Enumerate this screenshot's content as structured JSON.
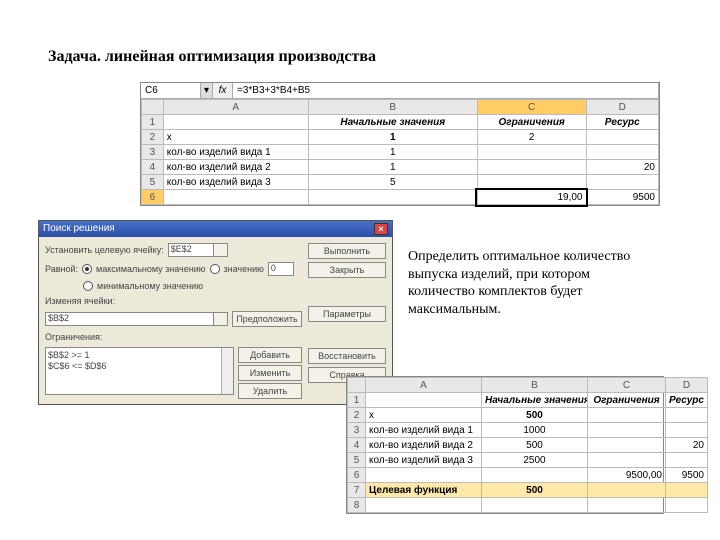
{
  "title": "Задача. линейная оптимизация производства",
  "description": "Определить оптимальное количество выпуска изделий, при котором количество комплектов будет максимальным.",
  "formula_bar": {
    "cell": "C6",
    "formula": "=3*B3+3*B4+B5"
  },
  "sheet1": {
    "cols": [
      "",
      "A",
      "B",
      "C",
      "D"
    ],
    "header": {
      "b": "Начальные значения",
      "c": "Ограничения",
      "d": "Ресурс"
    },
    "rows": [
      {
        "n": "1",
        "a": "",
        "b": "",
        "c": "",
        "d": ""
      },
      {
        "n": "2",
        "a": "x",
        "b": "1",
        "c": "2",
        "d": ""
      },
      {
        "n": "3",
        "a": "кол-во изделий вида 1",
        "b": "1",
        "c": "",
        "d": ""
      },
      {
        "n": "4",
        "a": "кол-во изделий вида 2",
        "b": "1",
        "c": "",
        "d": "20"
      },
      {
        "n": "5",
        "a": "кол-во изделий вида 3",
        "b": "5",
        "c": "",
        "d": ""
      },
      {
        "n": "6",
        "a": "",
        "b": "",
        "c": "19,00",
        "d": "9500"
      }
    ]
  },
  "sheet2": {
    "cols": [
      "",
      "A",
      "B",
      "C",
      "D"
    ],
    "header": {
      "b": "Начальные значения",
      "c": "Ограничения",
      "d": "Ресурс"
    },
    "rows": [
      {
        "n": "1",
        "a": "",
        "b": "",
        "c": "",
        "d": ""
      },
      {
        "n": "2",
        "a": "x",
        "b": "500",
        "c": "",
        "d": ""
      },
      {
        "n": "3",
        "a": "кол-во изделий вида 1",
        "b": "1000",
        "c": "",
        "d": ""
      },
      {
        "n": "4",
        "a": "кол-во изделий вида 2",
        "b": "500",
        "c": "",
        "d": "20"
      },
      {
        "n": "5",
        "a": "кол-во изделий вида 3",
        "b": "2500",
        "c": "",
        "d": ""
      },
      {
        "n": "6",
        "a": "",
        "b": "",
        "c": "9500,00",
        "d": "9500"
      },
      {
        "n": "7",
        "a": "Целевая функция",
        "b": "500",
        "c": "",
        "d": ""
      },
      {
        "n": "8",
        "a": "",
        "b": "",
        "c": "",
        "d": ""
      }
    ]
  },
  "solver": {
    "title": "Поиск решения",
    "target_lbl": "Установить целевую ячейку:",
    "target_val": "$E$2",
    "eq_lbl": "Равной:",
    "opt_max": "максимальному значению",
    "opt_val": "значению",
    "opt_val_input": "0",
    "opt_min": "минимальному значению",
    "changing_lbl": "Изменяя ячейки:",
    "changing_val": "$B$2",
    "constraints_lbl": "Ограничения:",
    "constraint1": "$B$2 >= 1",
    "constraint2": "$C$6 <= $D$6",
    "btn_execute": "Выполнить",
    "btn_close": "Закрыть",
    "btn_guess": "Предположить",
    "btn_add": "Добавить",
    "btn_change": "Изменить",
    "btn_delete": "Удалить",
    "btn_params": "Параметры",
    "btn_reset": "Восстановить",
    "btn_help": "Справка"
  }
}
